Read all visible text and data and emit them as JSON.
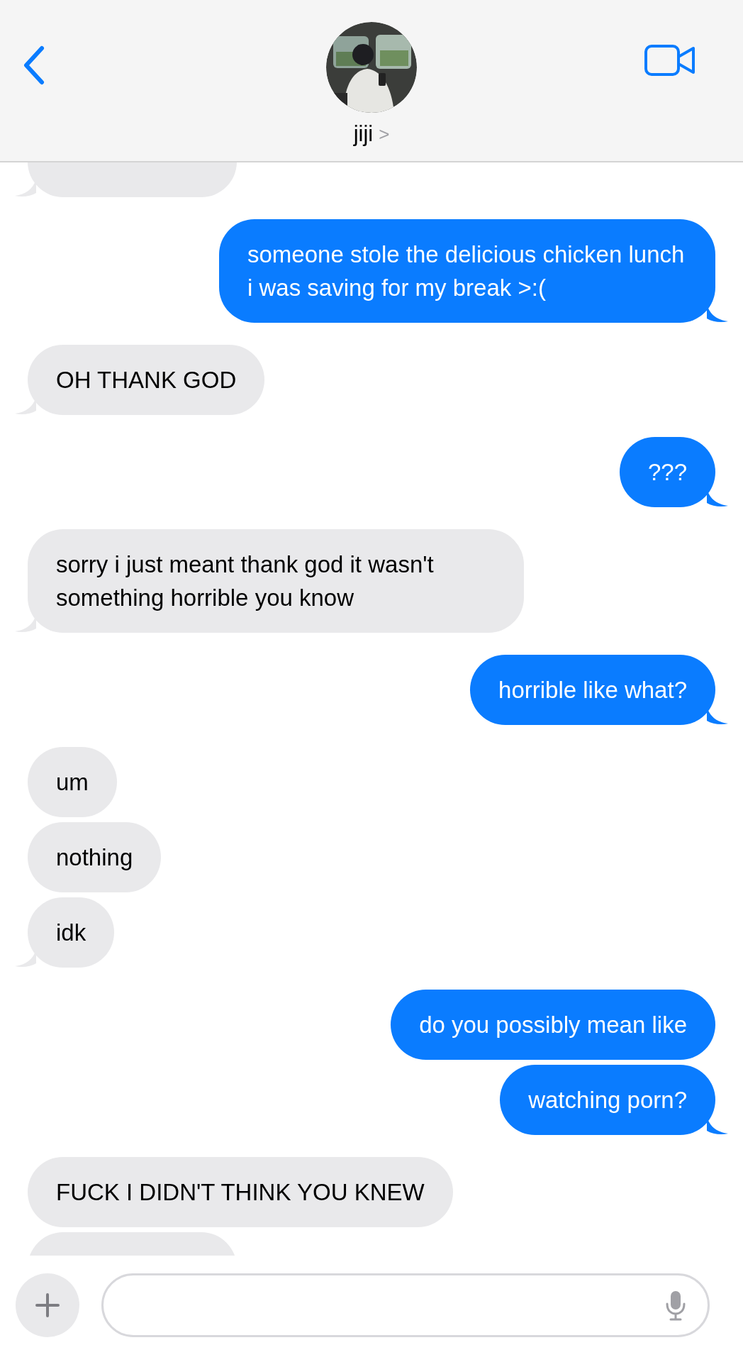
{
  "header": {
    "contact_name": "jiji",
    "chevron": ">"
  },
  "messages": [
    {
      "outgoing": false
    },
    {
      "outgoing": true,
      "text": "someone stole the delicious chicken lunch i was saving for my break >:("
    },
    {
      "outgoing": false,
      "text": "OH THANK GOD"
    },
    {
      "outgoing": true,
      "text": "???"
    },
    {
      "outgoing": false,
      "text": "sorry i just meant thank god it wasn't something horrible you know"
    },
    {
      "outgoing": true,
      "text": "horrible like what?"
    },
    {
      "outgoing": false,
      "text": "um"
    },
    {
      "outgoing": false,
      "text": "nothing"
    },
    {
      "outgoing": false,
      "text": "idk"
    },
    {
      "outgoing": true,
      "text": "do you possibly mean like"
    },
    {
      "outgoing": true,
      "text": "watching porn?"
    },
    {
      "outgoing": false,
      "text": "FUCK I DIDN'T THINK YOU KNEW"
    },
    {
      "outgoing": false
    }
  ]
}
